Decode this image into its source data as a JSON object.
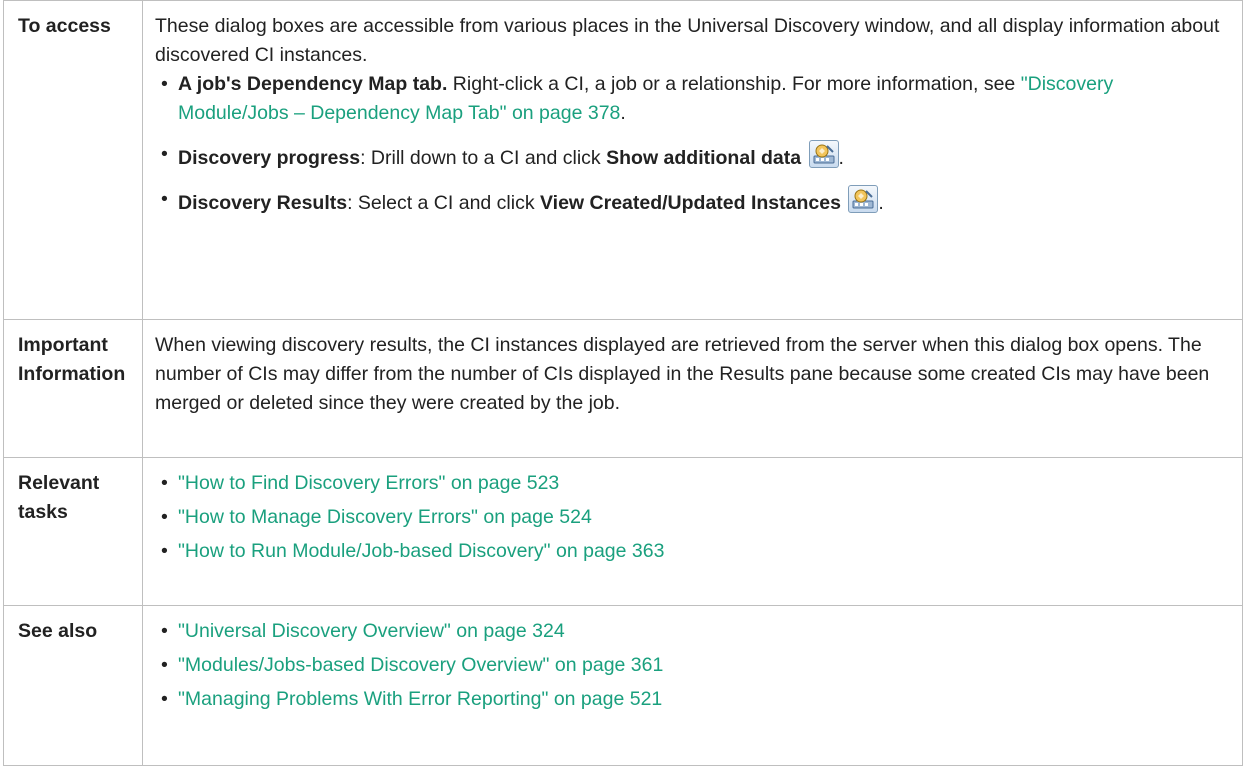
{
  "rows": {
    "access": {
      "label": "To access",
      "intro": "These dialog boxes are accessible from various places in the Universal Discovery window, and all display information about discovered CI instances.",
      "items": [
        {
          "bold": "A job's Dependency Map tab.",
          "text": " Right-click a CI, a job or a relationship. For more information, see ",
          "link": "\"Discovery Module/Jobs – Dependency Map Tab\" on page 378",
          "end": "."
        },
        {
          "bold": "Discovery progress",
          "text": ": Drill down to a CI and click ",
          "bold2": "Show additional data",
          "end": "."
        },
        {
          "bold": " Discovery Results",
          "text": ": Select a CI and click ",
          "bold2": "View Created/Updated Instances",
          "end": "."
        }
      ]
    },
    "important": {
      "label": "Important Information",
      "text": "When viewing discovery results, the CI instances displayed are retrieved from the server when this dialog box opens. The number of CIs may differ from the number of CIs displayed in the Results pane because some created CIs may have been merged or deleted since they were created by the job."
    },
    "tasks": {
      "label": "Relevant tasks",
      "links": [
        "\"How to Find Discovery Errors\" on page 523",
        "\"How to Manage Discovery Errors\" on page 524",
        "\"How to Run Module/Job-based Discovery\" on page 363"
      ]
    },
    "see_also": {
      "label": "See also",
      "links": [
        "\"Universal Discovery Overview\" on page 324",
        "\"Modules/Jobs-based Discovery Overview\" on page 361",
        "\"Managing Problems With Error Reporting\" on page 521"
      ]
    }
  },
  "bullet_char": "•",
  "colors": {
    "link": "#1aa07e",
    "border": "#bfbfbf",
    "text": "#222222"
  },
  "icons": {
    "show_additional_data": "show-additional-data-icon",
    "view_instances": "view-instances-icon"
  }
}
